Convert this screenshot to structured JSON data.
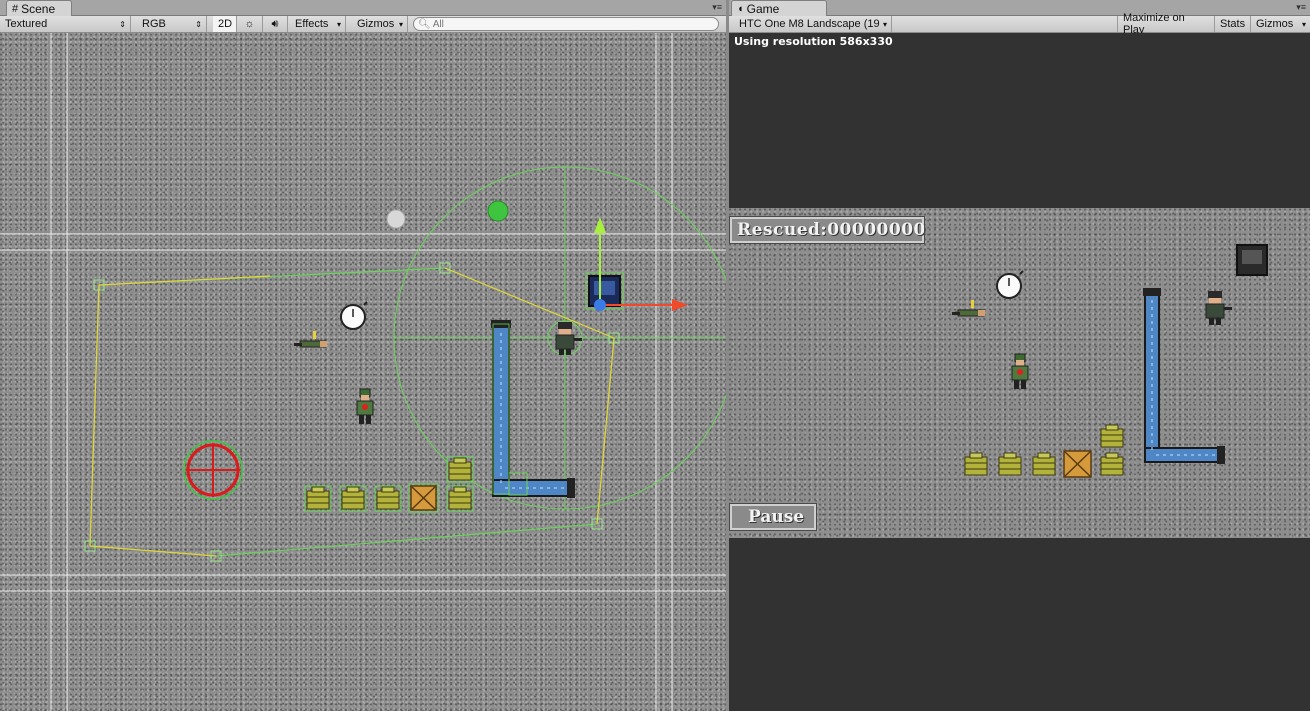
{
  "scene": {
    "tab_label": "Scene",
    "toolbar": {
      "draw_mode": "Textured",
      "render_mode": "RGB",
      "mode_2d": "2D",
      "effects": "Effects",
      "gizmos": "Gizmos",
      "search_placeholder": "All"
    }
  },
  "game": {
    "tab_label": "Game",
    "toolbar": {
      "aspect": "HTC One M8 Landscape (19",
      "maximize": "Maximize on Play",
      "stats": "Stats",
      "gizmos": "Gizmos"
    },
    "resolution_text": "Using resolution 586x330",
    "hud": {
      "rescued_label": "Rescued:",
      "rescued_value": "00000000",
      "pause_label": "Pause"
    }
  },
  "colors": {
    "selection_green": "#6bd35a",
    "selection_yellow": "#e8d23a",
    "gizmo_green": "#a8f03c",
    "gizmo_red": "#f04a2a",
    "gizmo_blue": "#3a7be8",
    "pipe_blue": "#4f86c6"
  }
}
